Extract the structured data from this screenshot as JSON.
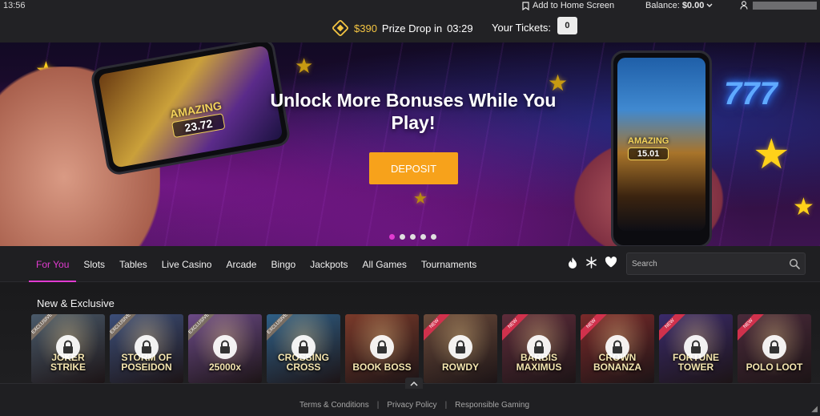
{
  "status": {
    "time": "13:56",
    "add_home": "Add to Home Screen",
    "balance_label": "Balance:",
    "balance_value": "$0.00"
  },
  "prize": {
    "amount": "$390",
    "text": "Prize Drop in",
    "countdown": "03:29",
    "tickets_label": "Your Tickets:",
    "tickets_count": "0"
  },
  "banner": {
    "headline": "Unlock More Bonuses While You Play!",
    "deposit_label": "DEPOSIT",
    "left_win_label": "AMAZING",
    "left_win_amount": "23.72",
    "right_win_label": "AMAZING",
    "right_win_amount": "15.01",
    "neon_sign": "777",
    "active_slide": 0,
    "slide_count": 5
  },
  "nav": {
    "tabs": [
      "For You",
      "Slots",
      "Tables",
      "Live Casino",
      "Arcade",
      "Bingo",
      "Jackpots",
      "All Games",
      "Tournaments"
    ],
    "active_tab": "For You",
    "search_placeholder": "Search"
  },
  "section": {
    "title": "New & Exclusive",
    "games": [
      {
        "title": "JOKER STRIKE",
        "badge": "EXCLUSIVE",
        "color": "#4a5a6a"
      },
      {
        "title": "STORM OF POSEIDON",
        "badge": "EXCLUSIVE",
        "color": "#3c4e78"
      },
      {
        "title": "25000x",
        "badge": "EXCLUSIVE",
        "color": "#6b4a86"
      },
      {
        "title": "CROSSING CROSS",
        "badge": "EXCLUSIVE",
        "color": "#2f5f86"
      },
      {
        "title": "BOOK BOSS",
        "badge": "",
        "color": "#7a3a2a"
      },
      {
        "title": "ROWDY",
        "badge": "NEW",
        "color": "#6a4a3a"
      },
      {
        "title": "BARBIS MAXIMUS",
        "badge": "NEW",
        "color": "#5e2c3a"
      },
      {
        "title": "CROWN BONANZA",
        "badge": "NEW",
        "color": "#7a2a2a"
      },
      {
        "title": "FORTUNE TOWER",
        "badge": "NEW",
        "color": "#3a2a6a"
      },
      {
        "title": "POLO LOOT",
        "badge": "NEW",
        "color": "#4a2a3a"
      }
    ]
  },
  "footer": {
    "terms": "Terms & Conditions",
    "privacy": "Privacy Policy",
    "responsible": "Responsible Gaming",
    "separator": "|"
  },
  "colors": {
    "accent": "#e13bd0",
    "deposit": "#f7a21b",
    "prize_gold": "#f4c542"
  }
}
